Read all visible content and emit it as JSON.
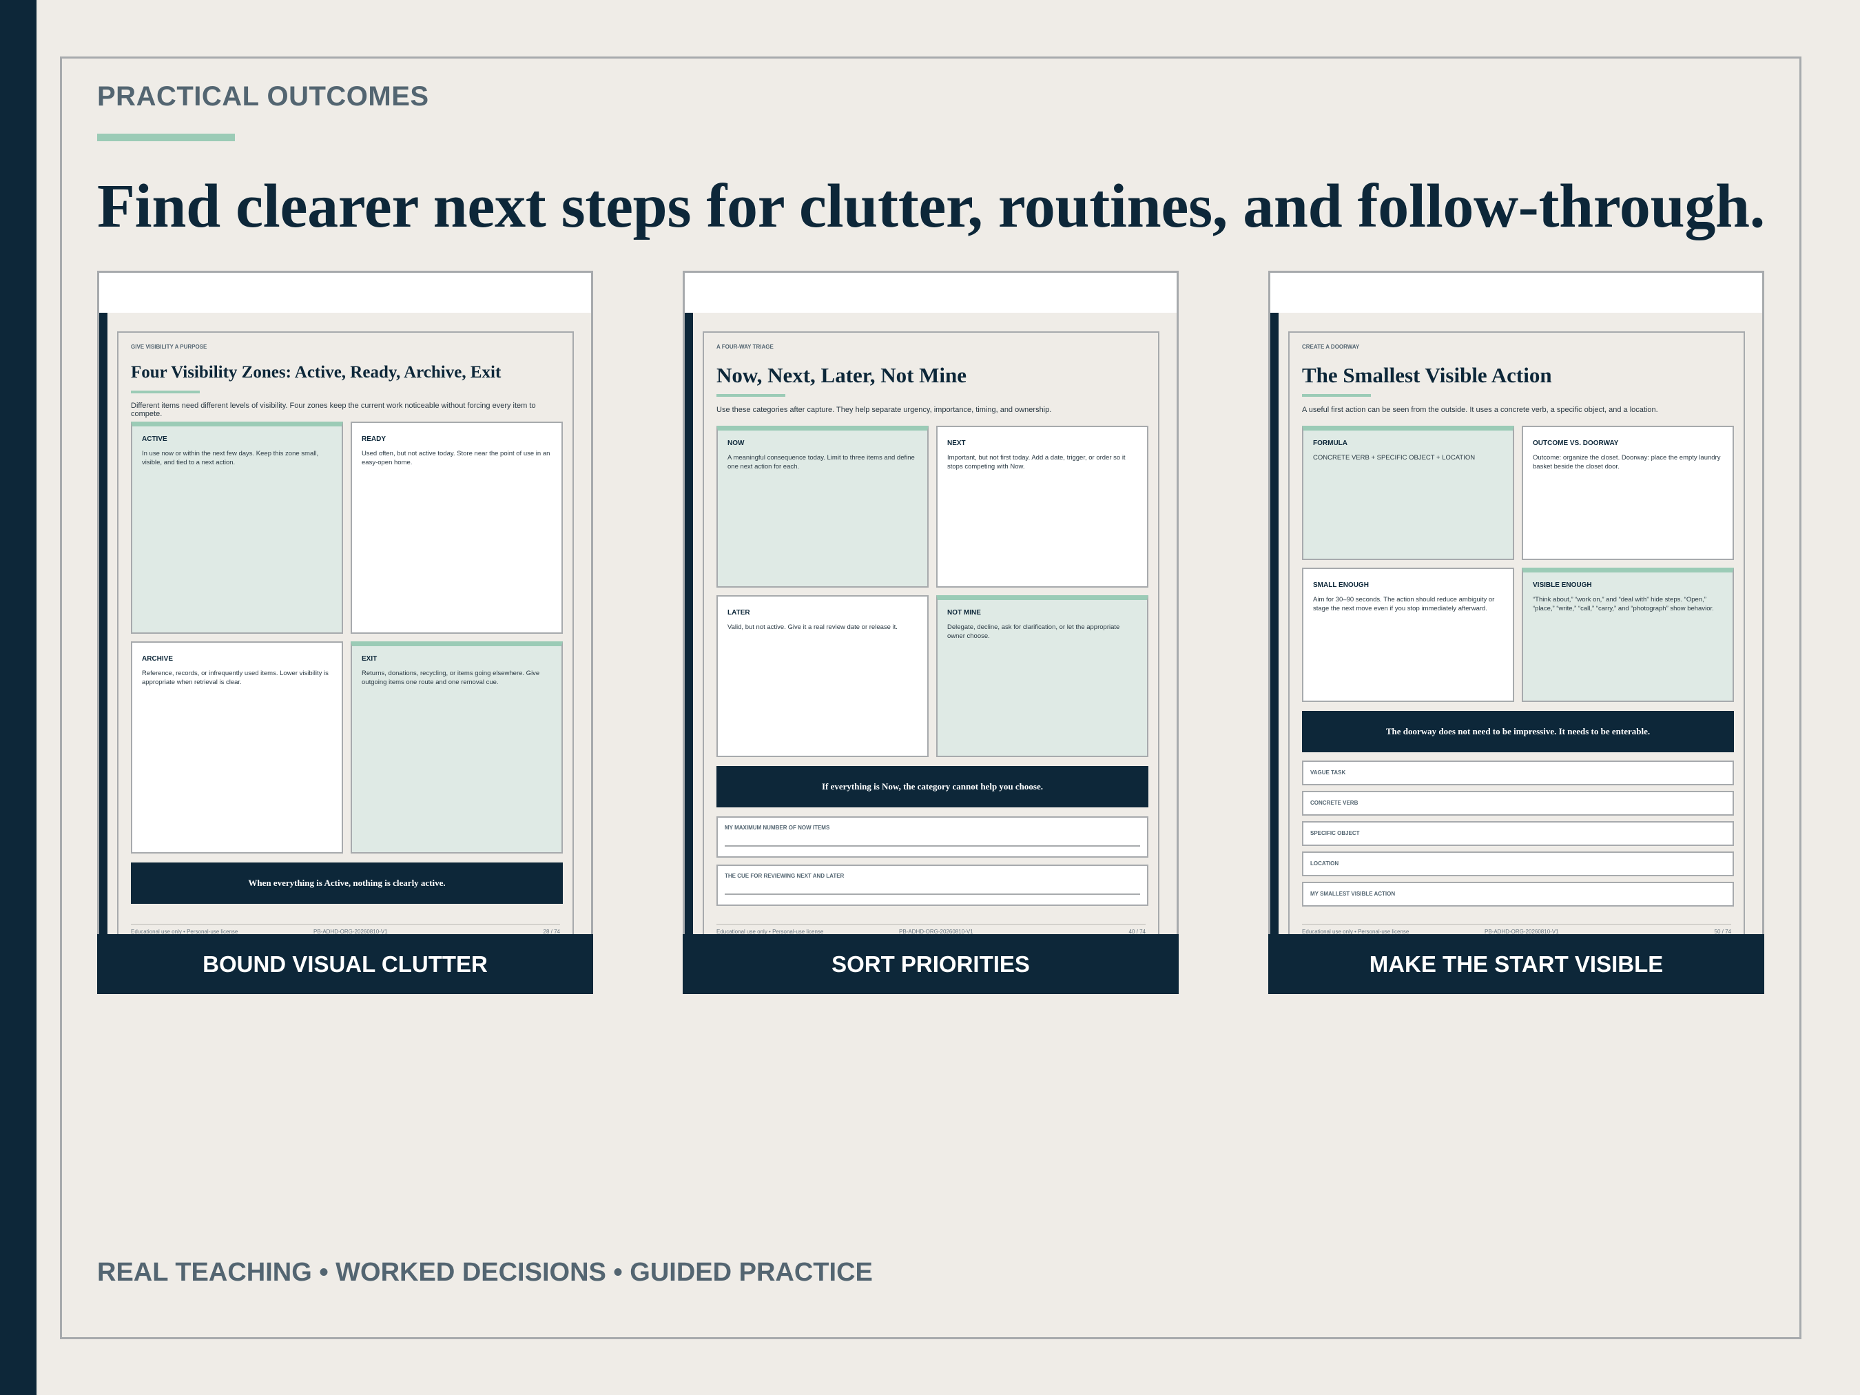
{
  "eyebrow": "PRACTICAL OUTCOMES",
  "headline": "Find clearer next steps for clutter, routines, and follow-through.",
  "tagline": "REAL TEACHING • WORKED DECISIONS • GUIDED PRACTICE",
  "colors": {
    "navy": "#0d2739",
    "accent": "#9bcbb6",
    "background": "#efece7",
    "slate": "#536571"
  },
  "cards": [
    {
      "caption": "BOUND VISUAL CLUTTER",
      "kicker": "GIVE VISIBILITY A PURPOSE",
      "title": "Four Visibility Zones: Active, Ready, Archive, Exit",
      "lead": "Different items need different levels of visibility. Four zones keep the current work noticeable without forcing every item to compete.",
      "boxes": [
        {
          "label": "ACTIVE",
          "text": "In use now or within the next few days. Keep this zone small, visible, and tied to a next action."
        },
        {
          "label": "READY",
          "text": "Used often, but not active today. Store near the point of use in an easy-open home."
        },
        {
          "label": "ARCHIVE",
          "text": "Reference, records, or infrequently used items. Lower visibility is appropriate when retrieval is clear."
        },
        {
          "label": "EXIT",
          "text": "Returns, donations, recycling, or items going elsewhere. Give outgoing items one route and one removal cue."
        }
      ],
      "note": "When everything is Active, nothing is clearly active.",
      "footer": {
        "left": "Educational use only • Personal-use license",
        "center": "PB-ADHD-ORG-20260810-V1",
        "right": "28 / 74"
      }
    },
    {
      "caption": "SORT PRIORITIES",
      "kicker": "A FOUR-WAY TRIAGE",
      "title": "Now, Next, Later, Not Mine",
      "lead": "Use these categories after capture. They help separate urgency, importance, timing, and ownership.",
      "boxes": [
        {
          "label": "NOW",
          "text": "A meaningful consequence today. Limit to three items and define one next action for each."
        },
        {
          "label": "NEXT",
          "text": "Important, but not first today. Add a date, trigger, or order so it stops competing with Now."
        },
        {
          "label": "LATER",
          "text": "Valid, but not active. Give it a real review date or release it."
        },
        {
          "label": "NOT MINE",
          "text": "Delegate, decline, ask for clarification, or let the appropriate owner choose."
        }
      ],
      "note": "If everything is Now, the category cannot help you choose.",
      "fields": [
        "MY MAXIMUM NUMBER OF NOW ITEMS",
        "THE CUE FOR REVIEWING NEXT AND LATER"
      ],
      "footer": {
        "left": "Educational use only • Personal-use license",
        "center": "PB-ADHD-ORG-20260810-V1",
        "right": "40 / 74"
      }
    },
    {
      "caption": "MAKE THE START VISIBLE",
      "kicker": "CREATE A DOORWAY",
      "title": "The Smallest Visible Action",
      "lead": "A useful first action can be seen from the outside. It uses a concrete verb, a specific object, and a location.",
      "boxes": [
        {
          "label": "FORMULA",
          "text": "CONCRETE VERB + SPECIFIC OBJECT + LOCATION"
        },
        {
          "label": "OUTCOME VS. DOORWAY",
          "text": "Outcome: organize the closet. Doorway: place the empty laundry basket beside the closet door."
        },
        {
          "label": "SMALL ENOUGH",
          "text": "Aim for 30–90 seconds. The action should reduce ambiguity or stage the next move even if you stop immediately afterward."
        },
        {
          "label": "VISIBLE ENOUGH",
          "text": "“Think about,” “work on,” and “deal with” hide steps. “Open,” “place,” “write,” “call,” “carry,” and “photograph” show behavior."
        }
      ],
      "note": "The doorway does not need to be impressive. It needs to be enterable.",
      "slots": [
        "VAGUE TASK",
        "CONCRETE VERB",
        "SPECIFIC OBJECT",
        "LOCATION",
        "MY SMALLEST VISIBLE ACTION"
      ],
      "footer": {
        "left": "Educational use only • Personal-use license",
        "center": "PB-ADHD-ORG-20260810-V1",
        "right": "50 / 74"
      }
    }
  ]
}
